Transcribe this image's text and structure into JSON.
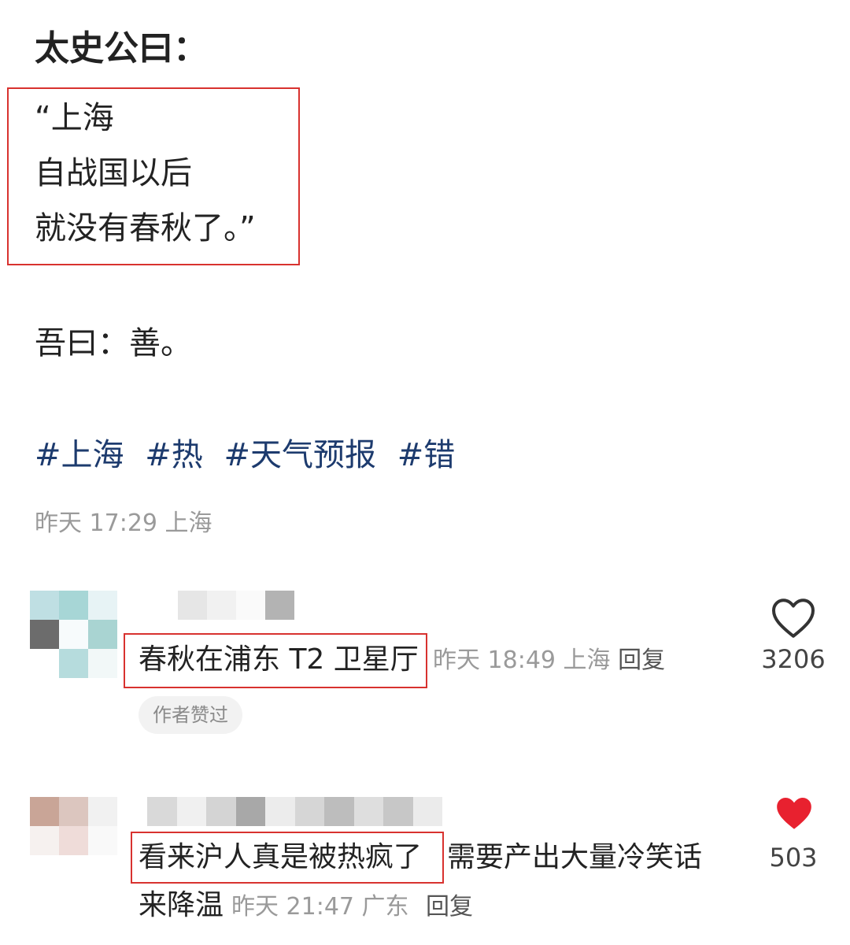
{
  "post": {
    "title": "太史公曰：",
    "quote_lines": [
      "“上海",
      "自战国以后",
      "就没有春秋了。”"
    ],
    "reply": "吾曰：善。",
    "tags": [
      "#上海",
      "#热",
      "#天气预报",
      "#错"
    ],
    "meta": "昨天 17:29 上海"
  },
  "comments": [
    {
      "text": "春秋在浦东 T2 卫星厅",
      "time": "昨天 18:49 上海",
      "reply_label": "回复",
      "badge": "作者赞过",
      "like_count": "3206",
      "liked": false,
      "like_icon": "heart-outline-icon"
    },
    {
      "text_highlight": "看来沪人真是被热疯了",
      "text_rest_line1": "需要产出大量冷笑话",
      "text_line2": "来降温",
      "time": "昨天 21:47 广东",
      "reply_label": "回复",
      "like_count": "503",
      "liked": true,
      "like_icon": "heart-filled-icon"
    }
  ],
  "colors": {
    "highlight_border": "#d8322f",
    "tag": "#1d3b6e",
    "liked_heart": "#e8212f",
    "muted": "#9a9a9a"
  }
}
